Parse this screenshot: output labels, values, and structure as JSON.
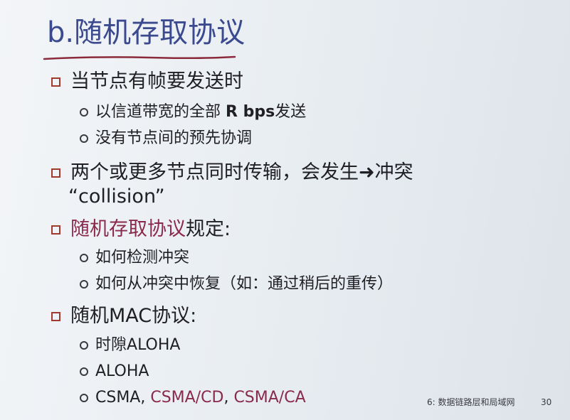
{
  "slide": {
    "title": "b.随机存取协议",
    "bullets": [
      {
        "text": "当节点有帧要发送时"
      },
      {
        "text_a": "以信道带宽的全部 ",
        "text_b": "R bps",
        "text_c": "发送"
      },
      {
        "text": "没有节点间的预先协调"
      },
      {
        "text": "两个或更多节点同时传输，会发生➜冲突",
        "continuation": "“collision”"
      },
      {
        "text_a": "随机存取协议",
        "text_b": "规定:"
      },
      {
        "text": "如何检测冲突"
      },
      {
        "text": "如何从冲突中恢复（如：通过稍后的重传）"
      },
      {
        "text_a": "随机",
        "text_b": "MAC",
        "text_c": "协议:"
      },
      {
        "text_a": "时隙",
        "text_b": "ALOHA"
      },
      {
        "text": "ALOHA"
      },
      {
        "text_a": "CSMA",
        "text_b": ", ",
        "text_c": "CSMA/CD",
        "text_d": ", ",
        "text_e": "CSMA/CA"
      }
    ],
    "footer": {
      "label": "6: 数据链路层和局域网",
      "page": "30"
    }
  },
  "colors": {
    "title": "#3b4a8e",
    "underline": "#8a2a3a",
    "bullet_square": "#a03a2e",
    "emphasis": "#8a2a4a",
    "text": "#1f1f24"
  }
}
